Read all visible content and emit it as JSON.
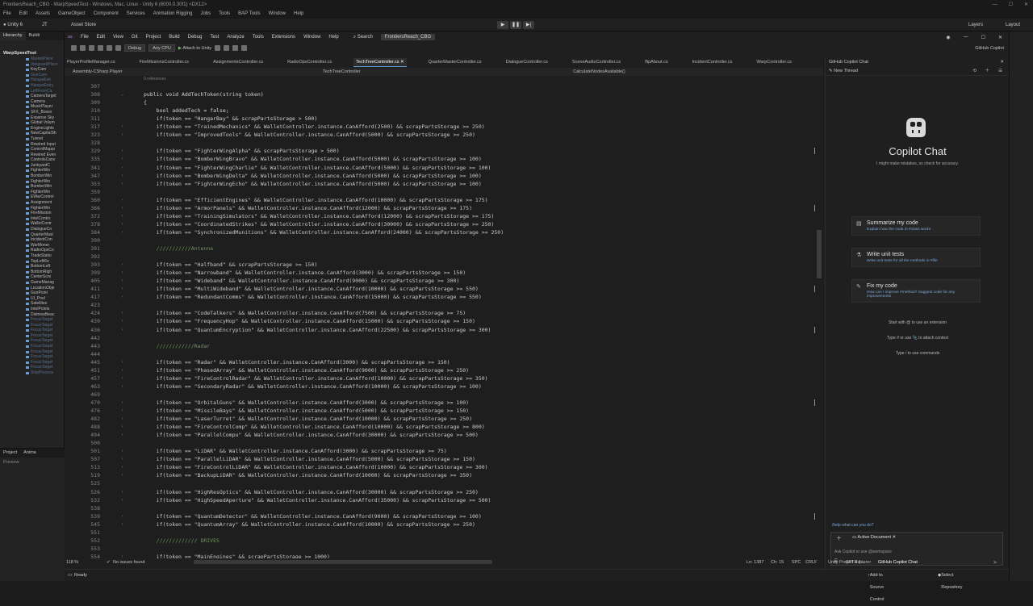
{
  "unity": {
    "title": "FrontiersReach_CBG - WarpSpeedTest - Windows, Mac, Linux - Unity 6 (6000.0.30f1) <DX12>",
    "menu": [
      "File",
      "Edit",
      "Assets",
      "GameObject",
      "Component",
      "Services",
      "Animation Rigging",
      "Jobs",
      "Tools",
      "BAP Tools",
      "Window",
      "Help"
    ],
    "account": "Unity 6",
    "jt": "JT",
    "asset_store": "Asset Store",
    "layers": "Layers",
    "layout": "Layout",
    "hierarchy_tab": "Hierarchy",
    "build_tab": "Buildi",
    "hierarchy_root": "WarpSpeedTest",
    "hierarchy_items": [
      {
        "label": "MarketPlace",
        "dim": true
      },
      {
        "label": "VanguardPlace",
        "dim": true
      },
      {
        "label": "KeyCam",
        "dim": false
      },
      {
        "label": "GunCam",
        "dim": true
      },
      {
        "label": "HangarExit",
        "dim": true
      },
      {
        "label": "HangarEntry",
        "dim": true
      },
      {
        "label": "LeftFromCa",
        "dim": true
      },
      {
        "label": "CameraTarget",
        "dim": false
      },
      {
        "label": "Camera",
        "dim": false
      },
      {
        "label": "MusicPlayer",
        "dim": false
      },
      {
        "label": "SFX_Boxes",
        "dim": false
      },
      {
        "label": "Expanse Sky",
        "dim": false
      },
      {
        "label": "Global Volum",
        "dim": false
      },
      {
        "label": "EngineLights",
        "dim": false
      },
      {
        "label": "NewCapitalSh",
        "dim": false
      },
      {
        "label": "Tunnel",
        "dim": false
      },
      {
        "label": "Rewired Input",
        "dim": false
      },
      {
        "label": "ControlMappi",
        "dim": false
      },
      {
        "label": "Rewired Even",
        "dim": false
      },
      {
        "label": "ControlsCanv",
        "dim": false
      },
      {
        "label": "JunkyardC",
        "dim": false
      },
      {
        "label": "FighterWin",
        "dim": false
      },
      {
        "label": "BomberWin",
        "dim": false
      },
      {
        "label": "FighterWin",
        "dim": false
      },
      {
        "label": "BomberWin",
        "dim": false
      },
      {
        "label": "FighterWin",
        "dim": false
      },
      {
        "label": "EWarControl",
        "dim": false
      },
      {
        "label": "Assignment",
        "dim": false
      },
      {
        "label": "FighterWin",
        "dim": false
      },
      {
        "label": "FireMission",
        "dim": false
      },
      {
        "label": "IntelContro",
        "dim": false
      },
      {
        "label": "WalletContr",
        "dim": false
      },
      {
        "label": "DialogueCo",
        "dim": false
      },
      {
        "label": "QuarterMast",
        "dim": false
      },
      {
        "label": "IncidentCon",
        "dim": false
      },
      {
        "label": "WarMoner",
        "dim": false
      },
      {
        "label": "RadioOpsCo",
        "dim": false
      },
      {
        "label": "TradeStatio",
        "dim": false
      },
      {
        "label": "TopLeftRo",
        "dim": false
      },
      {
        "label": "BottomLeft",
        "dim": false
      },
      {
        "label": "BottomRigh",
        "dim": false
      },
      {
        "label": "CenterScre",
        "dim": false
      },
      {
        "label": "GameManag",
        "dim": false
      },
      {
        "label": "LocationObje",
        "dim": false
      },
      {
        "label": "GunPoint",
        "dim": false
      },
      {
        "label": "UI_Pool",
        "dim": false
      },
      {
        "label": "Satellites",
        "dim": false
      },
      {
        "label": "IntelPoints",
        "dim": false
      },
      {
        "label": "DistressBeac",
        "dim": false
      },
      {
        "label": "FocusTarget",
        "dim": true
      },
      {
        "label": "FocusTarget",
        "dim": true
      },
      {
        "label": "FocusTarget",
        "dim": true
      },
      {
        "label": "FocusTarget",
        "dim": true
      },
      {
        "label": "FocusTarget",
        "dim": true
      },
      {
        "label": "FocusTarget",
        "dim": true
      },
      {
        "label": "FocusTarget",
        "dim": true
      },
      {
        "label": "FocusTarget",
        "dim": true
      },
      {
        "label": "FocusTarget",
        "dim": true
      },
      {
        "label": "FocusTarget",
        "dim": true
      },
      {
        "label": "ShipProcess",
        "dim": true
      }
    ],
    "project_tab": "Project",
    "anim_tab": "Anima",
    "preview_label": "Preview",
    "bottom": {
      "ready": "Ready",
      "add_source": "Add to Source Control",
      "select_repo": "Select Repository"
    }
  },
  "vs": {
    "menu": [
      "File",
      "Edit",
      "View",
      "Git",
      "Project",
      "Build",
      "Debug",
      "Test",
      "Analyze",
      "Tools",
      "Extensions",
      "Window",
      "Help"
    ],
    "search": "Search",
    "project_name": "FrontiersReach_CBG",
    "copilot_label": "GitHub Copilot",
    "config": "Debug",
    "platform": "Any CPU",
    "attach": "Attach to Unity",
    "tabs": [
      {
        "label": "PlayerProfileManager.cs",
        "active": false
      },
      {
        "label": "FireMissionsController.cs",
        "active": false
      },
      {
        "label": "AssignmentsController.cs",
        "active": false
      },
      {
        "label": "RadioOpsController.cs",
        "active": false
      },
      {
        "label": "TechTreeController.cs",
        "active": true
      },
      {
        "label": "QuarterMasterController.cs",
        "active": false
      },
      {
        "label": "DialogueController.cs",
        "active": false
      },
      {
        "label": "SceneAudioController.cs",
        "active": false
      },
      {
        "label": "flipAbout.cs",
        "active": false
      },
      {
        "label": "IncidentController.cs",
        "active": false
      },
      {
        "label": "WarpController.cs",
        "active": false
      }
    ],
    "nav": {
      "project": "Assembly-CSharp.Player",
      "type": "TechTreeController",
      "member": "CalculateNodesAvailable()"
    },
    "refs_label": "0 references",
    "code_lines": [
      {
        "ln": "307",
        "text": "",
        "kind": "blank"
      },
      {
        "ln": "308",
        "text": "public void AddTechToken(string token)",
        "kind": "sig"
      },
      {
        "ln": "309",
        "text": "{",
        "kind": "plain"
      },
      {
        "ln": "310",
        "text": "    bool addedTech = false;",
        "kind": "plain"
      },
      {
        "ln": "311",
        "text": "    if(token == \"HangarBay\" && scrapPartsStorage > 500)",
        "kind": "plain"
      },
      {
        "ln": "317",
        "text": "    if(token == \"TrainedMechanics\" && WalletController.instance.CanAfford(2500) && scrapPartsStorage >= 250)",
        "kind": "blur"
      },
      {
        "ln": "323",
        "text": "    if(token == \"ImprovedTools\" && WalletController.instance.CanAfford(5000) && scrapPartsStorage >= 250)",
        "kind": "blur"
      },
      {
        "ln": "328",
        "text": "",
        "kind": "blank"
      },
      {
        "ln": "329",
        "text": "    if(token == \"FighterWingAlpha\" && scrapPartsStorage > 500)",
        "kind": "blur"
      },
      {
        "ln": "335",
        "text": "    if(token == \"BomberWingBravo\" && WalletController.instance.CanAfford(5000) && scrapPartsStorage >= 100)",
        "kind": "blur"
      },
      {
        "ln": "341",
        "text": "    if(token == \"FighterWingCharlie\" && WalletController.instance.CanAfford(5000) && scrapPartsStorage >= 100)",
        "kind": "blur"
      },
      {
        "ln": "347",
        "text": "    if(token == \"BomberWingDelta\" && WalletController.instance.CanAfford(5000) && scrapPartsStorage >= 100)",
        "kind": "blur"
      },
      {
        "ln": "353",
        "text": "    if(token == \"FighterWingEcho\" && WalletController.instance.CanAfford(5000) && scrapPartsStorage >= 100)",
        "kind": "blur"
      },
      {
        "ln": "359",
        "text": "",
        "kind": "blank"
      },
      {
        "ln": "360",
        "text": "    if(token == \"EfficientEngines\" && WalletController.instance.CanAfford(10000) && scrapPartsStorage >= 175)",
        "kind": "blur"
      },
      {
        "ln": "366",
        "text": "    if(token == \"ArmorPanels\" && WalletController.instance.CanAfford(12000) && scrapPartsStorage >= 175)",
        "kind": "blur"
      },
      {
        "ln": "372",
        "text": "    if(token == \"TrainingSimulators\" && WalletController.instance.CanAfford(12000) && scrapPartsStorage >= 175)",
        "kind": "blur"
      },
      {
        "ln": "378",
        "text": "    if(token == \"CoordinatedStrikes\" && WalletController.instance.CanAfford(30000) && scrapPartsStorage >= 250)",
        "kind": "blur"
      },
      {
        "ln": "384",
        "text": "    if(token == \"SynchronizedMunitions\" && WalletController.instance.CanAfford(24000) && scrapPartsStorage >= 250)",
        "kind": "blur"
      },
      {
        "ln": "390",
        "text": "",
        "kind": "blank"
      },
      {
        "ln": "391",
        "text": "    ///////////Antenna",
        "kind": "comment"
      },
      {
        "ln": "392",
        "text": "",
        "kind": "blank"
      },
      {
        "ln": "393",
        "text": "    if(token == \"Halfband\" && scrapPartsStorage >= 150)",
        "kind": "blur"
      },
      {
        "ln": "399",
        "text": "    if(token == \"Narrowband\" && WalletController.instance.CanAfford(3000) && scrapPartsStorage >= 150)",
        "kind": "blur"
      },
      {
        "ln": "405",
        "text": "    if(token == \"Wideband\" && WalletController.instance.CanAfford(9000) && scrapPartsStorage >= 300)",
        "kind": "blur"
      },
      {
        "ln": "411",
        "text": "    if(token == \"MultiWideband\" && WalletController.instance.CanAfford(10000) && scrapPartsStorage >= 550)",
        "kind": "blur"
      },
      {
        "ln": "417",
        "text": "    if(token == \"RedundantComms\" && WalletController.instance.CanAfford(15000) && scrapPartsStorage >= 550)",
        "kind": "blur"
      },
      {
        "ln": "423",
        "text": "",
        "kind": "blank"
      },
      {
        "ln": "424",
        "text": "    if(token == \"CodeTalkers\" && WalletController.instance.CanAfford(7500) && scrapPartsStorage >= 75)",
        "kind": "blur"
      },
      {
        "ln": "430",
        "text": "    if(token == \"FrequencyHop\" && WalletController.instance.CanAfford(15000) && scrapPartsStorage >= 150)",
        "kind": "blur"
      },
      {
        "ln": "436",
        "text": "    if(token == \"QuantumEncryption\" && WalletController.instance.CanAfford(22500) && scrapPartsStorage >= 300)",
        "kind": "blur"
      },
      {
        "ln": "442",
        "text": "",
        "kind": "blank"
      },
      {
        "ln": "443",
        "text": "    ////////////Radar",
        "kind": "comment"
      },
      {
        "ln": "444",
        "text": "",
        "kind": "blank"
      },
      {
        "ln": "445",
        "text": "    if(token == \"Radar\" && WalletController.instance.CanAfford(3000) && scrapPartsStorage >= 150)",
        "kind": "blur"
      },
      {
        "ln": "451",
        "text": "    if(token == \"PhasedArray\" && WalletController.instance.CanAfford(9000) && scrapPartsStorage >= 250)",
        "kind": "blur"
      },
      {
        "ln": "457",
        "text": "    if(token == \"FireControlRadar\" && WalletController.instance.CanAfford(10000) && scrapPartsStorage >= 350)",
        "kind": "blur"
      },
      {
        "ln": "463",
        "text": "    if(token == \"SecondaryRadar\" && WalletController.instance.CanAfford(10000) && scrapPartsStorage >= 100)",
        "kind": "blur"
      },
      {
        "ln": "469",
        "text": "",
        "kind": "blank"
      },
      {
        "ln": "470",
        "text": "    if(token == \"OrbitalGuns\" && WalletController.instance.CanAfford(3000) && scrapPartsStorage >= 100)",
        "kind": "blur"
      },
      {
        "ln": "476",
        "text": "    if(token == \"MissileBays\" && WalletController.instance.CanAfford(5000) && scrapPartsStorage >= 150)",
        "kind": "blur"
      },
      {
        "ln": "482",
        "text": "    if(token == \"LaserTurret\" && WalletController.instance.CanAfford(10000) && scrapPartsStorage >= 250)",
        "kind": "blur"
      },
      {
        "ln": "488",
        "text": "    if(token == \"FireControlComp\" && WalletController.instance.CanAfford(10000) && scrapPartsStorage >= 800)",
        "kind": "blur"
      },
      {
        "ln": "494",
        "text": "    if(token == \"ParallelCompu\" && WalletController.instance.CanAfford(30000) && scrapPartsStorage >= 500)",
        "kind": "blur"
      },
      {
        "ln": "500",
        "text": "",
        "kind": "blank"
      },
      {
        "ln": "501",
        "text": "    if(token == \"LiDAR\" && WalletController.instance.CanAfford(3000) && scrapPartsStorage >= 75)",
        "kind": "blur"
      },
      {
        "ln": "507",
        "text": "    if(token == \"ParallelLiDAR\" && WalletController.instance.CanAfford(5000) && scrapPartsStorage >= 150)",
        "kind": "blur"
      },
      {
        "ln": "513",
        "text": "    if(token == \"FireControlLiDAR\" && WalletController.instance.CanAfford(10000) && scrapPartsStorage >= 300)",
        "kind": "blur"
      },
      {
        "ln": "519",
        "text": "    if(token == \"BackupLiDAR\" && WalletController.instance.CanAfford(10000) && scrapPartsStorage >= 350)",
        "kind": "blur"
      },
      {
        "ln": "525",
        "text": "",
        "kind": "blank"
      },
      {
        "ln": "526",
        "text": "    if(token == \"HighResOptics\" && WalletController.instance.CanAfford(30000) && scrapPartsStorage >= 250)",
        "kind": "blur"
      },
      {
        "ln": "532",
        "text": "    if(token == \"HighSpeedAperture\" && WalletController.instance.CanAfford(35000) && scrapPartsStorage >= 500)",
        "kind": "blur"
      },
      {
        "ln": "538",
        "text": "",
        "kind": "blank"
      },
      {
        "ln": "539",
        "text": "    if(token == \"QuantumDetector\" && WalletController.instance.CanAfford(9000) && scrapPartsStorage >= 100)",
        "kind": "blur"
      },
      {
        "ln": "545",
        "text": "    if(token == \"QuantumArray\" && WalletController.instance.CanAfford(10000) && scrapPartsStorage >= 250)",
        "kind": "blur"
      },
      {
        "ln": "551",
        "text": "",
        "kind": "blank"
      },
      {
        "ln": "552",
        "text": "    ///////////// DRIVES",
        "kind": "comment"
      },
      {
        "ln": "553",
        "text": "",
        "kind": "blank"
      },
      {
        "ln": "554",
        "text": "    if(token == \"MainEngines\" && scrapPartsStorage >= 1000)",
        "kind": "blur"
      }
    ],
    "status": {
      "zoom": "118 %",
      "issues": "No issues found",
      "ln": "Ln: 1387",
      "ch": "Ch: 15",
      "spc": "SPC",
      "crlf": "CRLF"
    },
    "bottom_tabs": [
      "Unity Project Explorer",
      "GitHub Copilot Chat"
    ]
  },
  "copilot": {
    "header": "GitHub Copilot Chat",
    "thread": "New Thread",
    "title": "Copilot Chat",
    "subtitle": "I might make mistakes, so check for accuracy.",
    "suggestions": [
      {
        "title": "Summarize my code",
        "desc": "Explain how the code in #class works",
        "icon": "book-icon"
      },
      {
        "title": "Write unit tests",
        "desc": "Write unit tests for all the methods in #file",
        "icon": "flask-icon"
      },
      {
        "title": "Fix my code",
        "desc": "How can I improve #method? Suggest code for any improvements",
        "icon": "wrench-icon"
      }
    ],
    "tips": [
      "Start with  @  to use an extension",
      "Type  #  or use  📎  to attach context",
      "Type  /  to use commands"
    ],
    "help": "/help what can you do?",
    "active_document": "Active Document",
    "placeholder": "Ask Copilot or use @workspace",
    "model": "GPT-4.1"
  }
}
